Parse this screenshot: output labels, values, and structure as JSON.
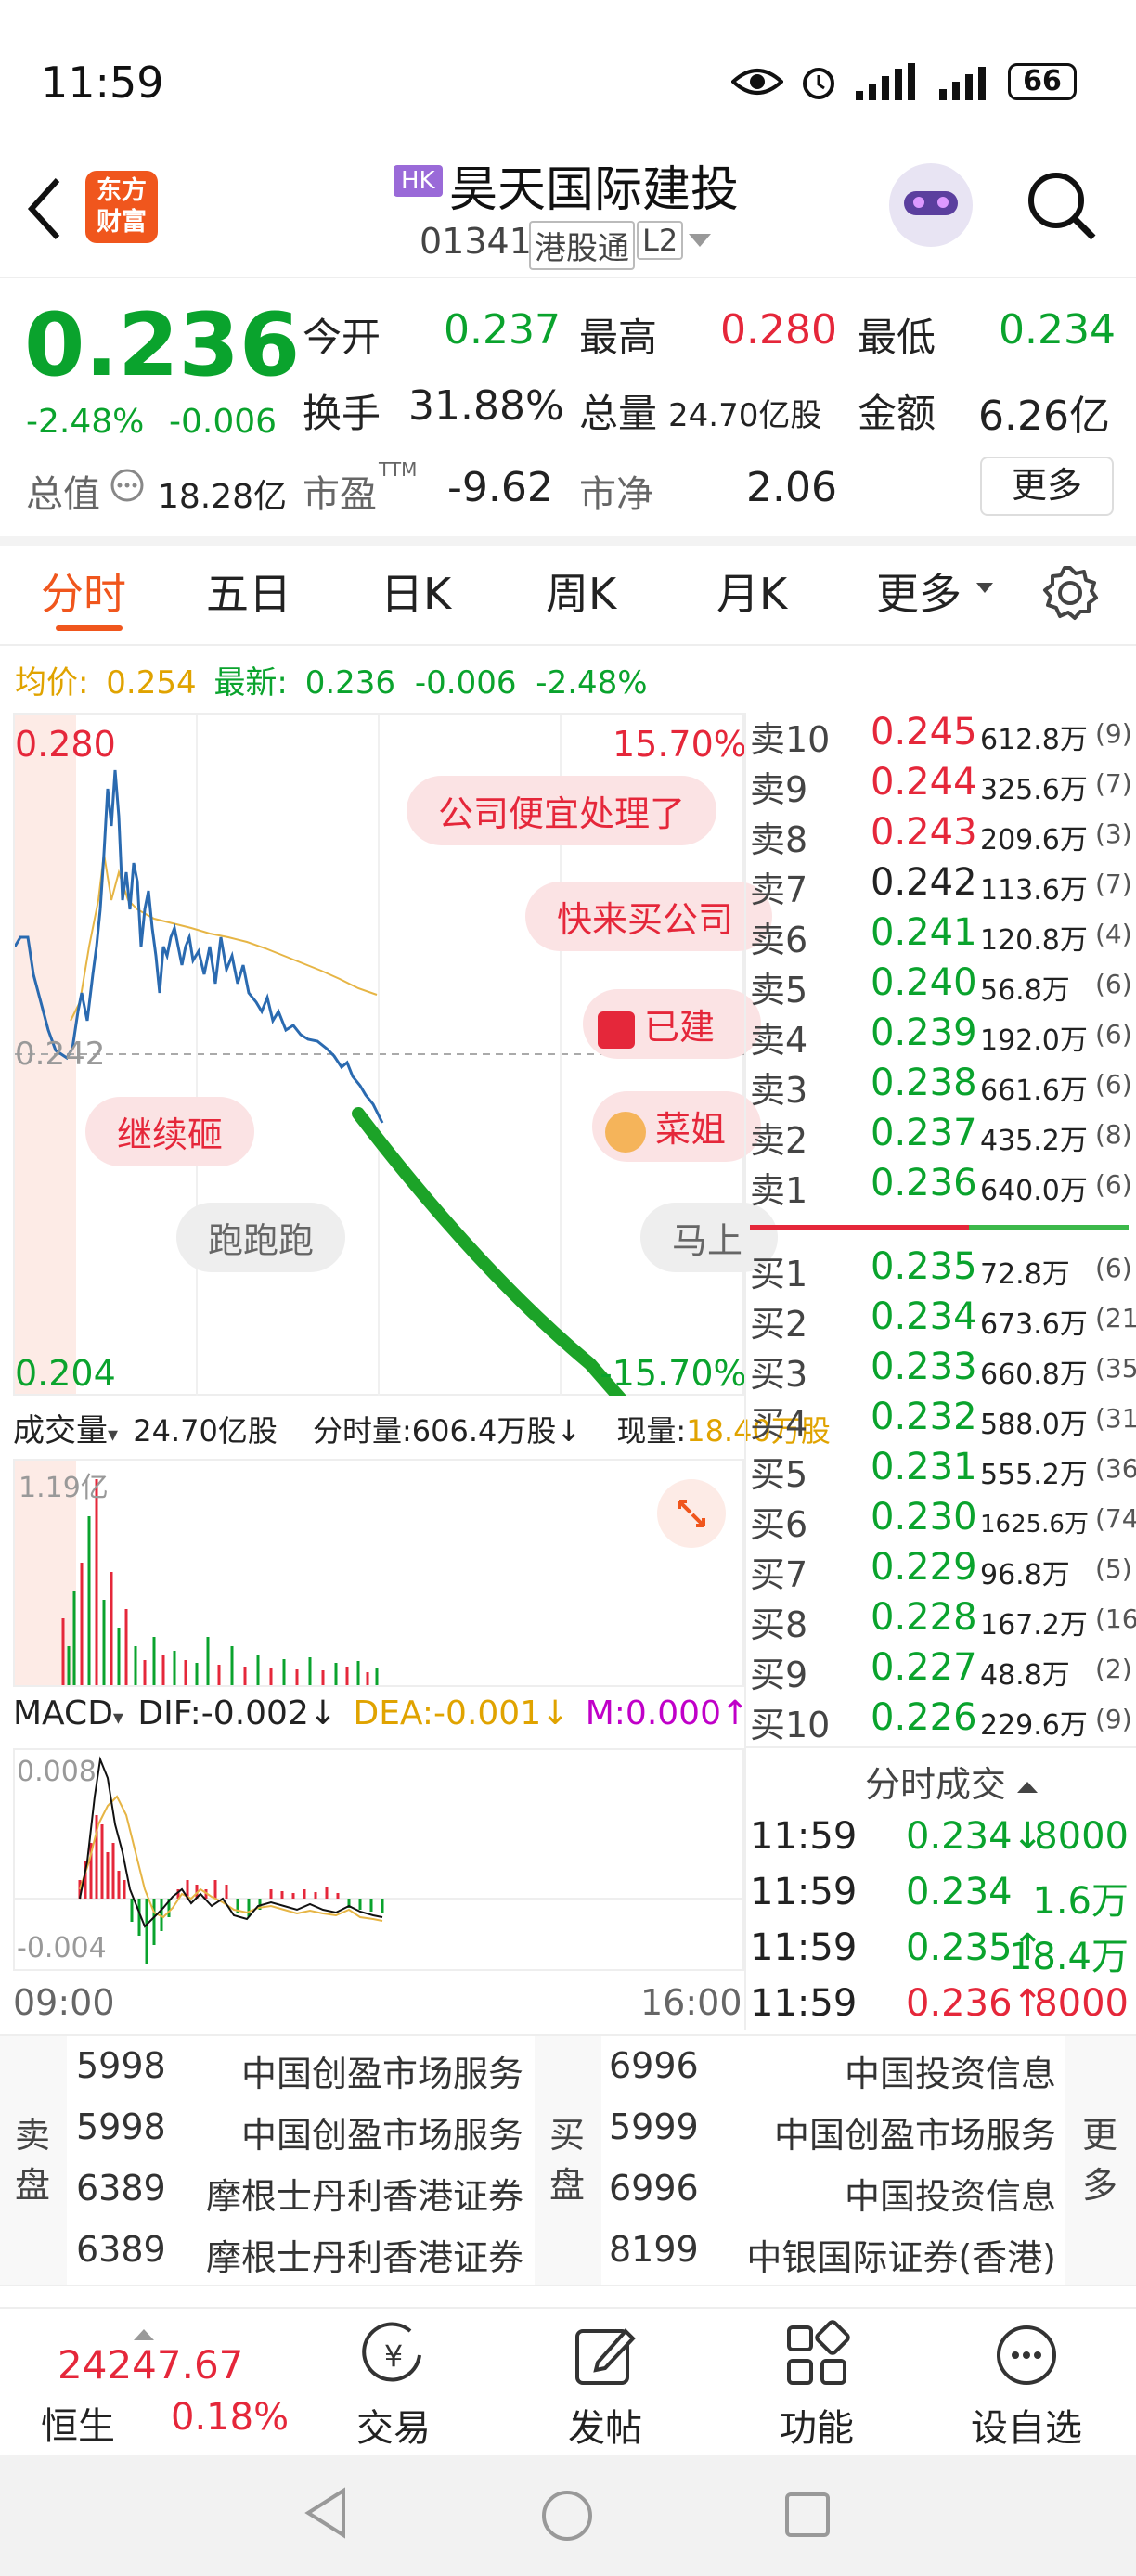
{
  "status_bar": {
    "time": "11:59",
    "battery": "66"
  },
  "header": {
    "logo_line1": "东方",
    "logo_line2": "财富",
    "market_badge": "HK",
    "stock_name": "昊天国际建投",
    "code": "01341",
    "connect": "港股通",
    "level": "L2"
  },
  "quote": {
    "price": "0.236",
    "change_pct": "-2.48%",
    "change": "-0.006",
    "open_label": "今开",
    "open": "0.237",
    "high_label": "最高",
    "high": "0.280",
    "low_label": "最低",
    "low": "0.234",
    "turnover_label": "换手",
    "turnover": "31.88%",
    "volume_label": "总量",
    "volume": "24.70亿股",
    "amount_label": "金额",
    "amount": "6.26亿",
    "mktcap_label": "总值",
    "mktcap": "18.28亿",
    "pe_label": "市盈",
    "pe_sup": "TTM",
    "pe": "-9.62",
    "pb_label": "市净",
    "pb": "2.06",
    "more_label": "更多"
  },
  "tabs": [
    "分时",
    "五日",
    "日K",
    "周K",
    "月K",
    "更多"
  ],
  "info_line": {
    "avg_label": "均价:",
    "avg": "0.254",
    "last_label": "最新:",
    "last": "0.236",
    "chg": "-0.006",
    "pct": "-2.48%"
  },
  "chart": {
    "top_price": "0.280",
    "top_pct": "15.70%",
    "mid_price": "0.242",
    "bottom_price": "0.204",
    "bottom_pct": "-15.70%",
    "time_start": "09:00",
    "time_end": "16:00"
  },
  "comments": [
    "公司便宜处理了",
    "快来买公司",
    "已建",
    "继续砸",
    "菜姐",
    "跑跑跑",
    "马上"
  ],
  "volume_bar": {
    "label": "成交量",
    "total": "24.70亿股",
    "period": "分时量:606.4万股↓",
    "now_label": "现量:",
    "now": "18.40万股",
    "axis_max": "1.19亿"
  },
  "macd": {
    "label": "MACD",
    "dif": "DIF:-0.002↓",
    "dea": "DEA:-0.001↓",
    "m": "M:0.000↑",
    "axis_max": "0.008",
    "axis_min": "-0.004"
  },
  "order_book": {
    "asks": [
      {
        "label": "卖10",
        "price": "0.245",
        "vol": "612.8万",
        "count": "(9)",
        "color": "#e5273a"
      },
      {
        "label": "卖9",
        "price": "0.244",
        "vol": "325.6万",
        "count": "(7)",
        "color": "#e5273a"
      },
      {
        "label": "卖8",
        "price": "0.243",
        "vol": "209.6万",
        "count": "(3)",
        "color": "#e5273a"
      },
      {
        "label": "卖7",
        "price": "0.242",
        "vol": "113.6万",
        "count": "(7)",
        "color": "#222222"
      },
      {
        "label": "卖6",
        "price": "0.241",
        "vol": "120.8万",
        "count": "(4)",
        "color": "#0aa32d"
      },
      {
        "label": "卖5",
        "price": "0.240",
        "vol": "56.8万",
        "count": "(6)",
        "color": "#0aa32d"
      },
      {
        "label": "卖4",
        "price": "0.239",
        "vol": "192.0万",
        "count": "(6)",
        "color": "#0aa32d"
      },
      {
        "label": "卖3",
        "price": "0.238",
        "vol": "661.6万",
        "count": "(6)",
        "color": "#0aa32d"
      },
      {
        "label": "卖2",
        "price": "0.237",
        "vol": "435.2万",
        "count": "(8)",
        "color": "#0aa32d"
      },
      {
        "label": "卖1",
        "price": "0.236",
        "vol": "640.0万",
        "count": "(6)",
        "color": "#0aa32d"
      }
    ],
    "bids": [
      {
        "label": "买1",
        "price": "0.235",
        "vol": "72.8万",
        "count": "(6)",
        "color": "#0aa32d"
      },
      {
        "label": "买2",
        "price": "0.234",
        "vol": "673.6万",
        "count": "(21)",
        "color": "#0aa32d"
      },
      {
        "label": "买3",
        "price": "0.233",
        "vol": "660.8万",
        "count": "(35)",
        "color": "#0aa32d"
      },
      {
        "label": "买4",
        "price": "0.232",
        "vol": "588.0万",
        "count": "(31)",
        "color": "#0aa32d"
      },
      {
        "label": "买5",
        "price": "0.231",
        "vol": "555.2万",
        "count": "(36)",
        "color": "#0aa32d"
      },
      {
        "label": "买6",
        "price": "0.230",
        "vol": "1625.6万",
        "count": "(74)",
        "color": "#0aa32d"
      },
      {
        "label": "买7",
        "price": "0.229",
        "vol": "96.8万",
        "count": "(5)",
        "color": "#0aa32d"
      },
      {
        "label": "买8",
        "price": "0.228",
        "vol": "167.2万",
        "count": "(16)",
        "color": "#0aa32d"
      },
      {
        "label": "买9",
        "price": "0.227",
        "vol": "48.8万",
        "count": "(2)",
        "color": "#0aa32d"
      },
      {
        "label": "买10",
        "price": "0.226",
        "vol": "229.6万",
        "count": "(9)",
        "color": "#0aa32d"
      }
    ]
  },
  "trades": {
    "title": "分时成交",
    "rows": [
      {
        "time": "11:59",
        "price": "0.234↓",
        "vol": "8000",
        "color": "#0aa32d"
      },
      {
        "time": "11:59",
        "price": "0.234",
        "vol": "1.6万",
        "color": "#0aa32d"
      },
      {
        "time": "11:59",
        "price": "0.235↑",
        "vol": "18.4万",
        "color": "#0aa32d"
      },
      {
        "time": "11:59",
        "price": "0.236↑",
        "vol": "8000",
        "color": "#e5273a"
      }
    ]
  },
  "brokers": {
    "sell_label": "卖盘",
    "buy_label": "买盘",
    "more_label": "更多",
    "sell": [
      {
        "id": "5998",
        "name": "中国创盈市场服务"
      },
      {
        "id": "5998",
        "name": "中国创盈市场服务"
      },
      {
        "id": "6389",
        "name": "摩根士丹利香港证券"
      },
      {
        "id": "6389",
        "name": "摩根士丹利香港证券"
      }
    ],
    "buy": [
      {
        "id": "6996",
        "name": "中国投资信息"
      },
      {
        "id": "5999",
        "name": "中国创盈市场服务"
      },
      {
        "id": "6996",
        "name": "中国投资信息"
      },
      {
        "id": "8199",
        "name": "中银国际证券(香港)"
      }
    ]
  },
  "bottom_nav": {
    "index_value": "24247.67",
    "index_name": "恒生",
    "index_pct": "0.18%",
    "items": [
      "交易",
      "发帖",
      "功能",
      "设自选"
    ]
  }
}
